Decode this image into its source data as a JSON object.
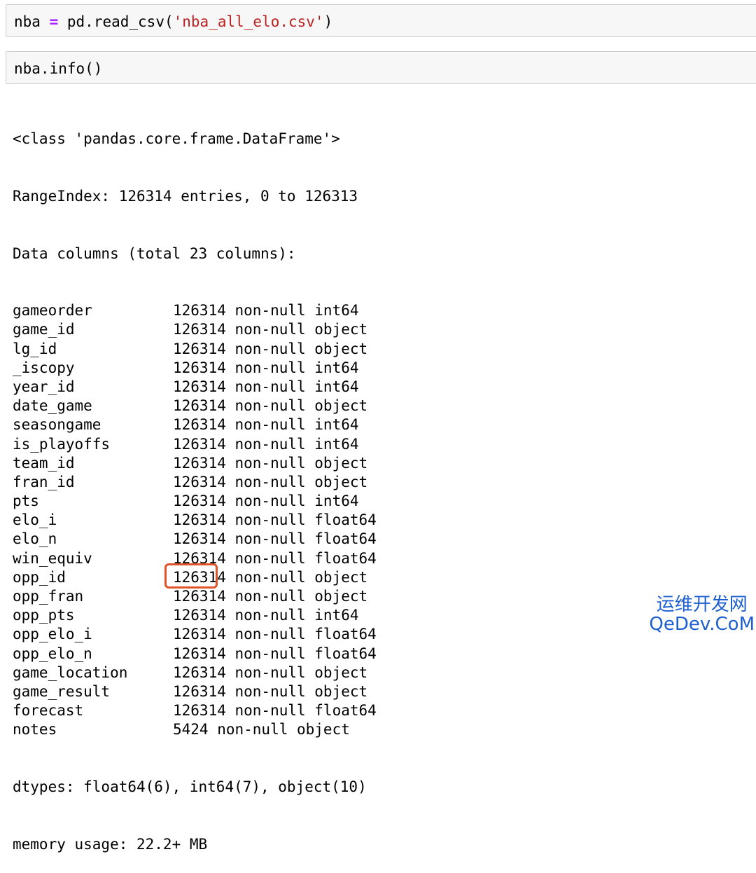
{
  "cells": [
    {
      "var": "nba",
      "op": "=",
      "call_prefix": " pd.read_csv(",
      "string_arg": "'nba_all_elo.csv'",
      "call_suffix": ")"
    },
    {
      "code": "nba.info()"
    }
  ],
  "output": {
    "class_line": "<class 'pandas.core.frame.DataFrame'>",
    "range_index": "RangeIndex: 126314 entries, 0 to 126313",
    "data_columns_header": "Data columns (total 23 columns):",
    "columns": [
      {
        "name": "gameorder",
        "info": "126314 non-null int64"
      },
      {
        "name": "game_id",
        "info": "126314 non-null object"
      },
      {
        "name": "lg_id",
        "info": "126314 non-null object"
      },
      {
        "name": "_iscopy",
        "info": "126314 non-null int64"
      },
      {
        "name": "year_id",
        "info": "126314 non-null int64"
      },
      {
        "name": "date_game",
        "info": "126314 non-null object"
      },
      {
        "name": "seasongame",
        "info": "126314 non-null int64"
      },
      {
        "name": "is_playoffs",
        "info": "126314 non-null int64"
      },
      {
        "name": "team_id",
        "info": "126314 non-null object"
      },
      {
        "name": "fran_id",
        "info": "126314 non-null object"
      },
      {
        "name": "pts",
        "info": "126314 non-null int64"
      },
      {
        "name": "elo_i",
        "info": "126314 non-null float64"
      },
      {
        "name": "elo_n",
        "info": "126314 non-null float64"
      },
      {
        "name": "win_equiv",
        "info": "126314 non-null float64"
      },
      {
        "name": "opp_id",
        "info": "126314 non-null object"
      },
      {
        "name": "opp_fran",
        "info": "126314 non-null object"
      },
      {
        "name": "opp_pts",
        "info": "126314 non-null int64"
      },
      {
        "name": "opp_elo_i",
        "info": "126314 non-null float64"
      },
      {
        "name": "opp_elo_n",
        "info": "126314 non-null float64"
      },
      {
        "name": "game_location",
        "info": "126314 non-null object"
      },
      {
        "name": "game_result",
        "info": "126314 non-null object"
      },
      {
        "name": "forecast",
        "info": "126314 non-null float64"
      },
      {
        "name": "notes",
        "info": "5424 non-null object"
      }
    ],
    "dtypes": "dtypes: float64(6), int64(7), object(10)",
    "memory": "memory usage: 22.2+ MB"
  },
  "highlight_color": "#e0542a",
  "watermark": {
    "line1": "运维开发网",
    "line2": "QeDev.CoM",
    "color": "#1d5fd0"
  }
}
